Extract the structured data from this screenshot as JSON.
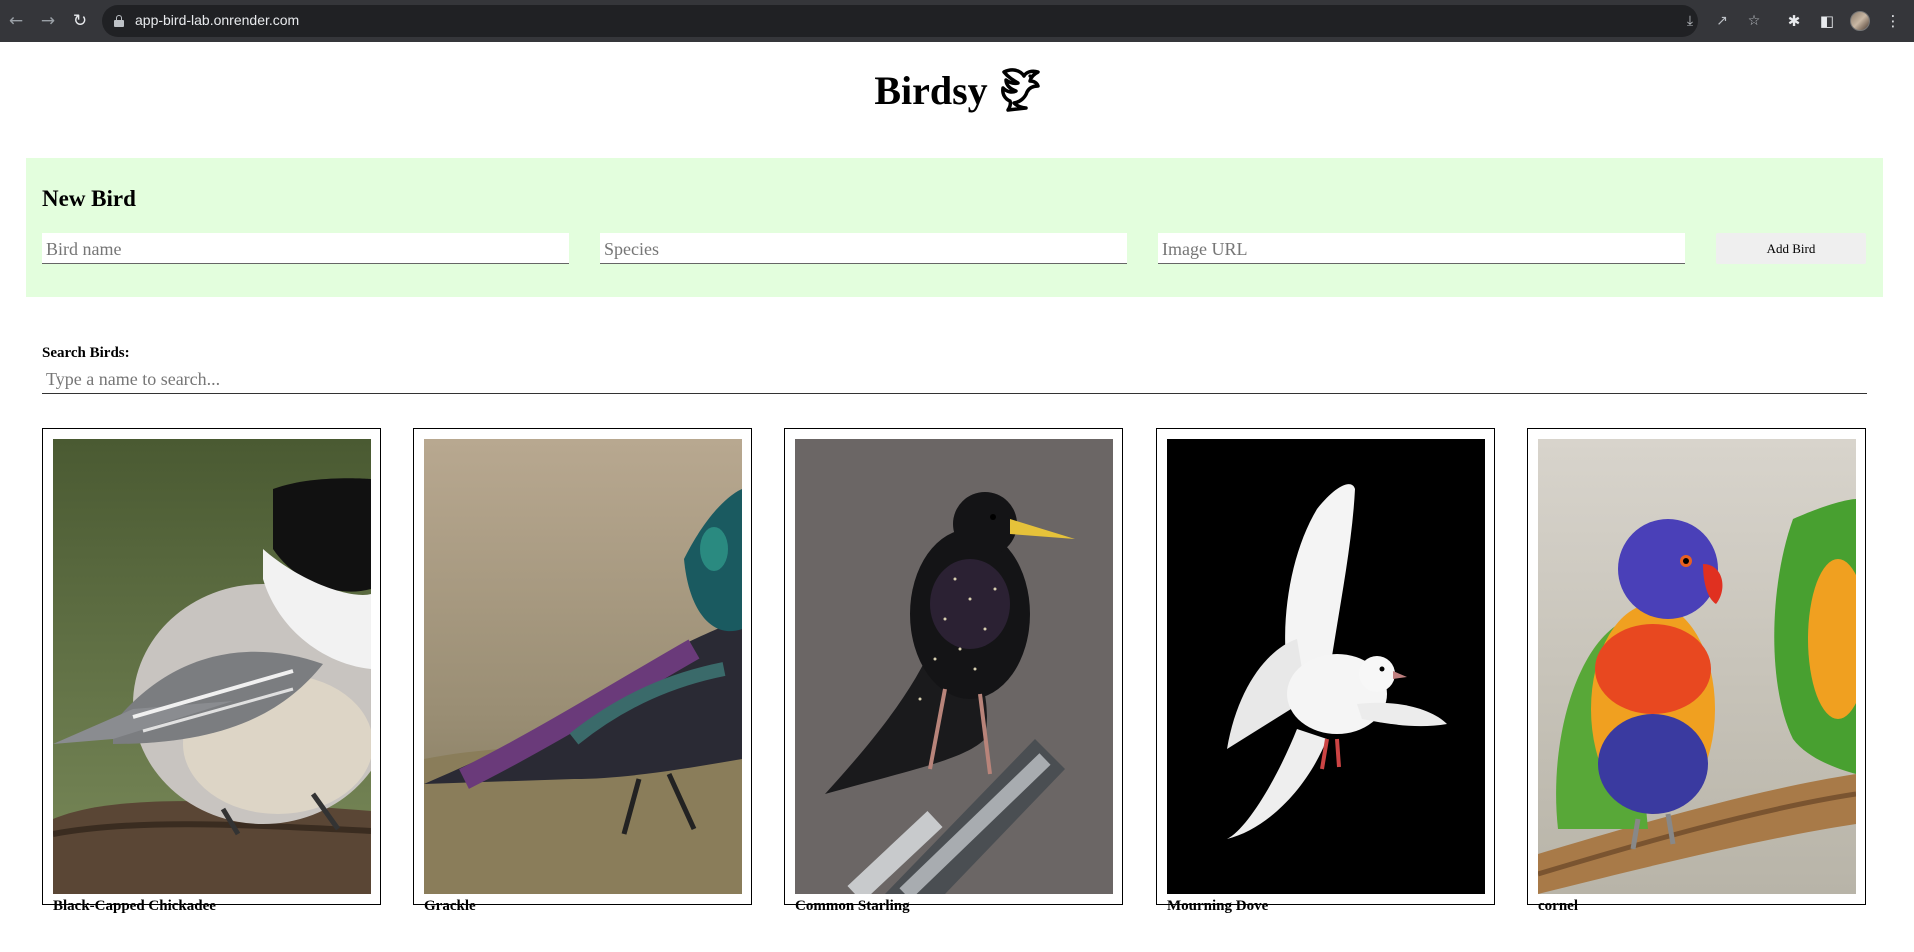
{
  "browser": {
    "url": "app-bird-lab.onrender.com"
  },
  "site": {
    "title": "Birdsy"
  },
  "new_bird_form": {
    "heading": "New Bird",
    "name_placeholder": "Bird name",
    "species_placeholder": "Species",
    "image_placeholder": "Image URL",
    "submit_label": "Add Bird",
    "background_color": "#e3fedd"
  },
  "search": {
    "label": "Search Birds:",
    "placeholder": "Type a name to search..."
  },
  "birds": [
    {
      "name": "Black-Capped Chickadee"
    },
    {
      "name": "Grackle"
    },
    {
      "name": "Common Starling"
    },
    {
      "name": "Mourning Dove"
    },
    {
      "name": "cornel"
    }
  ]
}
